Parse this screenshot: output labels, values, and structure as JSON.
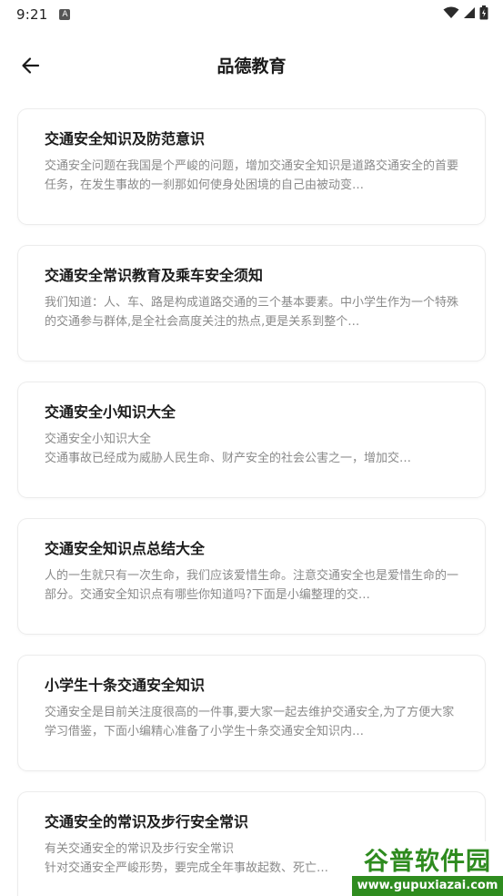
{
  "status_bar": {
    "time": "9:21",
    "notif_glyph": "A"
  },
  "header": {
    "title": "品德教育",
    "back_icon": "arrow-left-icon"
  },
  "articles": [
    {
      "title": "交通安全知识及防范意识",
      "summary": "交通安全问题在我国是个严峻的问题，增加交通安全知识是道路交通安全的首要任务，在发生事故的一刹那如何使身处困境的自己由被动变…"
    },
    {
      "title": "交通安全常识教育及乘车安全须知",
      "summary": "我们知道：人、车、路是构成道路交通的三个基本要素。中小学生作为一个特殊的交通参与群体,是全社会高度关注的热点,更是关系到整个…"
    },
    {
      "title": "交通安全小知识大全",
      "summary": "交通安全小知识大全\n交通事故已经成为威胁人民生命、财产安全的社会公害之一，增加交…"
    },
    {
      "title": "交通安全知识点总结大全",
      "summary": "人的一生就只有一次生命，我们应该爱惜生命。注意交通安全也是爱惜生命的一部分。交通安全知识点有哪些你知道吗?下面是小编整理的交…"
    },
    {
      "title": "小学生十条交通安全知识",
      "summary": "交通安全是目前关注度很高的一件事,要大家一起去维护交通安全,为了方便大家学习借鉴，下面小编精心准备了小学生十条交通安全知识内…"
    },
    {
      "title": "交通安全的常识及步行安全常识",
      "summary": "有关交通安全的常识及步行安全常识\n针对交通安全严峻形势，要完成全年事故起数、死亡…"
    }
  ],
  "watermark": {
    "name": "谷普软件园",
    "url": "www.gupuxiazai.com"
  }
}
